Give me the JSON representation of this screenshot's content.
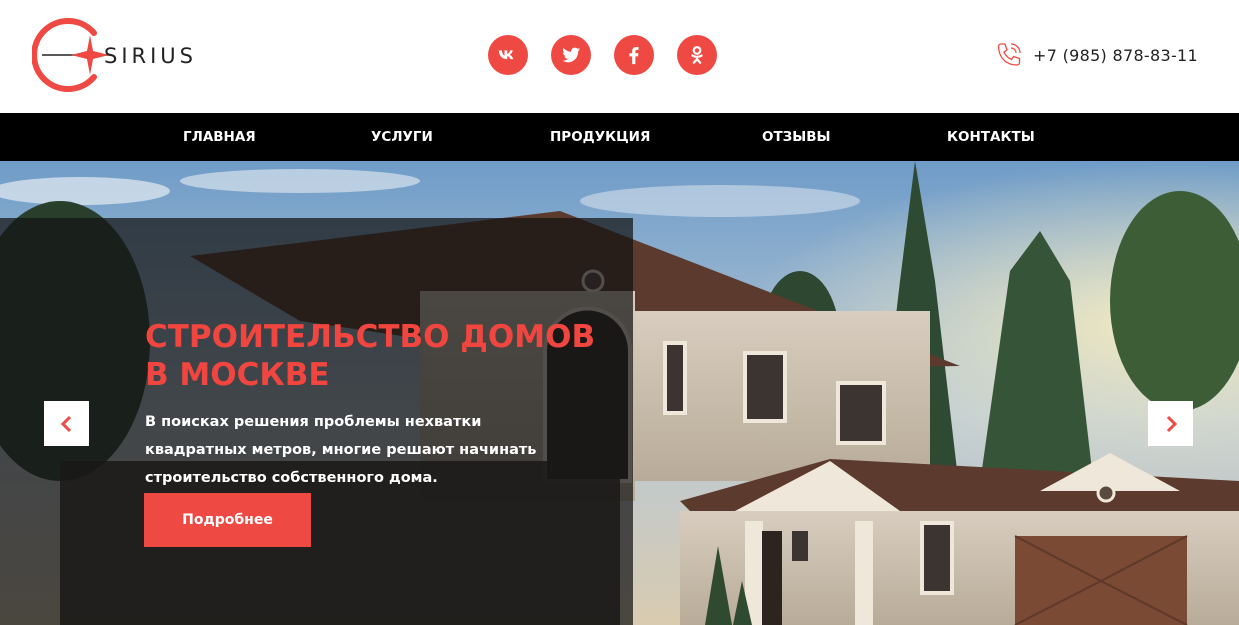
{
  "brand": {
    "name": "SIRIUS"
  },
  "socials": [
    {
      "icon": "vk-icon",
      "label": "vk"
    },
    {
      "icon": "twitter-icon",
      "label": "twitter"
    },
    {
      "icon": "facebook-icon",
      "label": "f"
    },
    {
      "icon": "odnoklassniki-icon",
      "label": "ok"
    }
  ],
  "contact": {
    "phone": "+7 (985) 878-83-11"
  },
  "nav": {
    "items": [
      {
        "label": "ГЛАВНАЯ"
      },
      {
        "label": "УСЛУГИ"
      },
      {
        "label": "ПРОДУКЦИЯ"
      },
      {
        "label": "ОТЗЫВЫ"
      },
      {
        "label": "КОНТАКТЫ"
      }
    ]
  },
  "hero": {
    "title_line1": "СТРОИТЕЛЬСТВО ДОМОВ",
    "title_line2": "В МОСКВЕ",
    "text_line1": "В поисках решения проблемы нехватки",
    "text_line2": "квадратных метров, многие решают начинать",
    "text_line3": "строительство собственного дома.",
    "button_label": "Подробнее"
  },
  "colors": {
    "accent": "#ee4a43",
    "nav_bg": "#000000",
    "title": "#f0463f"
  }
}
